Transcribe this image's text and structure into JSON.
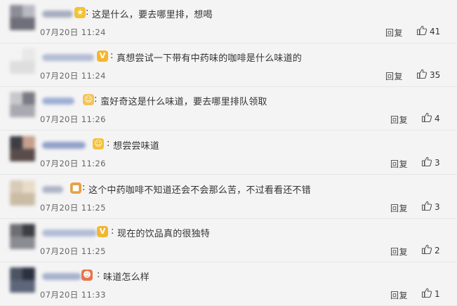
{
  "comments": [
    {
      "text": "这是什么，要去哪里排，想喝",
      "time": "07月20日 11:24",
      "reply_label": "回复",
      "likes": "41",
      "avatar_colors": [
        "#8d8d98",
        "#b9b9c2",
        "#6f6f7a"
      ],
      "name_color": "#9aa1b6",
      "badge_color": "#f3c237",
      "badge_glyph": "★"
    },
    {
      "text": "真想尝试一下带有中药味的咖啡是什么味道的",
      "time": "07月20日 11:24",
      "reply_label": "回复",
      "likes": "35",
      "avatar_colors": [
        "#f3f3f3",
        "#e8e8e8",
        "#dedede"
      ],
      "name_color": "#a7b3cf",
      "badge_color": "#f5b52e",
      "badge_glyph": "V"
    },
    {
      "text": "蛮好奇这是什么味道，要去哪里排队领取",
      "time": "07月20日 11:26",
      "reply_label": "回复",
      "likes": "4",
      "avatar_colors": [
        "#c8c8cc",
        "#7a7a84",
        "#a9a9b1"
      ],
      "name_color": "#8fa3cf",
      "badge_color": "#f1c45a",
      "badge_glyph": "☺"
    },
    {
      "text": "想尝尝味道",
      "time": "07月20日 11:26",
      "reply_label": "回复",
      "likes": "3",
      "avatar_colors": [
        "#3d3d44",
        "#c79f8c",
        "#5a4c4a"
      ],
      "name_color": "#8193c2",
      "badge_color": "#f3c237",
      "badge_glyph": "☺"
    },
    {
      "text": "这个中药咖啡不知道还会不会那么苦，不过看看还不错",
      "time": "07月20日 11:25",
      "reply_label": "回复",
      "likes": "3",
      "avatar_colors": [
        "#d8cbb8",
        "#e8dcc8",
        "#cbbca6"
      ],
      "name_color": "#a2aac0",
      "badge_color": "#e7a243",
      "badge_glyph": "■"
    },
    {
      "text": "现在的饮品真的很独特",
      "time": "07月20日 11:25",
      "reply_label": "回复",
      "likes": "2",
      "avatar_colors": [
        "#6e6e74",
        "#3d3d45",
        "#8b8b92"
      ],
      "name_color": "#a6b2d1",
      "badge_color": "#f1b734",
      "badge_glyph": "V"
    },
    {
      "text": "味道怎么样",
      "time": "07月20日 11:33",
      "reply_label": "回复",
      "likes": "1",
      "avatar_colors": [
        "#4c5363",
        "#2c3140",
        "#5d667a"
      ],
      "name_color": "#99a6c6",
      "badge_color": "#e9744a",
      "badge_glyph": "☻"
    }
  ]
}
